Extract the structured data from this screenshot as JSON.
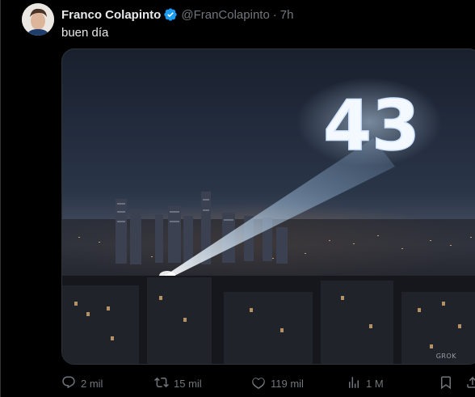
{
  "author": {
    "name": "Franco Colapinto",
    "handle": "@FranColapinto",
    "separator": "·",
    "time": "7h",
    "verified": true
  },
  "tweet": {
    "text": "buen día"
  },
  "media": {
    "number": "43",
    "watermark": "GROK"
  },
  "actions": {
    "replies": "2 mil",
    "reposts": "15 mil",
    "likes": "119 mil",
    "views": "1 M"
  },
  "colors": {
    "background": "#000000",
    "text": "#e7e9ea",
    "secondary": "#71767b",
    "verified": "#1d9bf0"
  }
}
